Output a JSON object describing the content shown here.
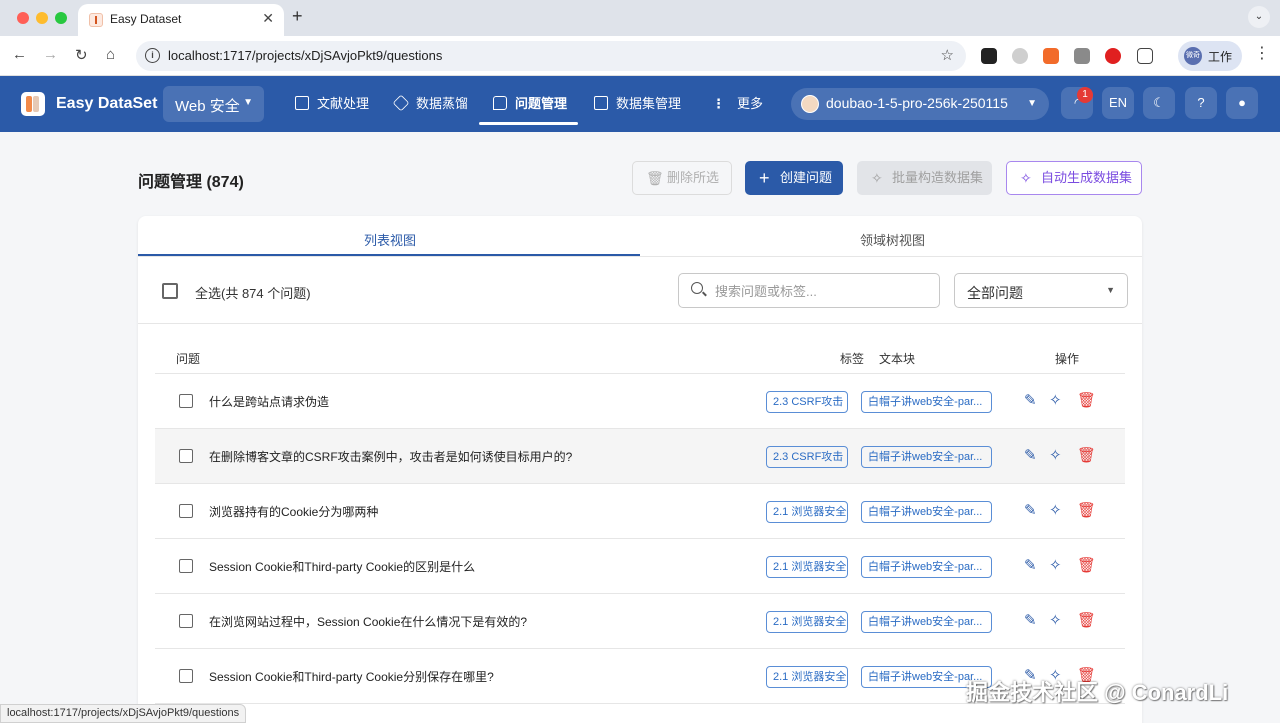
{
  "browser": {
    "tab_title": "Easy Dataset",
    "url": "localhost:1717/projects/xDjSAvjoPkt9/questions",
    "profile_label": "工作",
    "profile_avatar_text": "微奇"
  },
  "app": {
    "name": "Easy DataSet",
    "project": "Web 安全",
    "nav": [
      {
        "label": "文献处理",
        "icon": "document-icon"
      },
      {
        "label": "数据蒸馏",
        "icon": "cube-icon"
      },
      {
        "label": "问题管理",
        "icon": "chat-icon",
        "active": true
      },
      {
        "label": "数据集管理",
        "icon": "grid-icon"
      },
      {
        "label": "更多",
        "icon": "more-icon"
      }
    ],
    "model": "doubao-1-5-pro-256k-250115",
    "task_badge": "1",
    "lang": "EN",
    "accent_color": "#2b5aa8"
  },
  "page": {
    "title": "问题管理 (874)",
    "buttons": {
      "delete_selected": "删除所选",
      "create_question": "创建问题",
      "batch_build": "批量构造数据集",
      "auto_generate": "自动生成数据集"
    },
    "view_tabs": {
      "list": "列表视图",
      "tree": "领域树视图"
    },
    "select_all": "全选(共 874 个问题)",
    "search_placeholder": "搜索问题或标签...",
    "filter_value": "全部问题",
    "columns": {
      "question": "问题",
      "label": "标签",
      "chunk": "文本块",
      "actions": "操作"
    },
    "rows": [
      {
        "question": "什么是跨站点请求伪造",
        "label": "2.3 CSRF攻击",
        "chunk": "白帽子讲web安全-par..."
      },
      {
        "question": "在删除博客文章的CSRF攻击案例中，攻击者是如何诱使目标用户的?",
        "label": "2.3 CSRF攻击",
        "chunk": "白帽子讲web安全-par..."
      },
      {
        "question": "浏览器持有的Cookie分为哪两种",
        "label": "2.1 浏览器安全",
        "chunk": "白帽子讲web安全-par..."
      },
      {
        "question": "Session Cookie和Third-party Cookie的区别是什么",
        "label": "2.1 浏览器安全",
        "chunk": "白帽子讲web安全-par..."
      },
      {
        "question": "在浏览网站过程中，Session Cookie在什么情况下是有效的?",
        "label": "2.1 浏览器安全",
        "chunk": "白帽子讲web安全-par..."
      },
      {
        "question": "Session Cookie和Third-party Cookie分别保存在哪里?",
        "label": "2.1 浏览器安全",
        "chunk": "白帽子讲web安全-par..."
      }
    ]
  },
  "status_url": "localhost:1717/projects/xDjSAvjoPkt9/questions",
  "watermark": "掘金技术社区 @ ConardLi"
}
